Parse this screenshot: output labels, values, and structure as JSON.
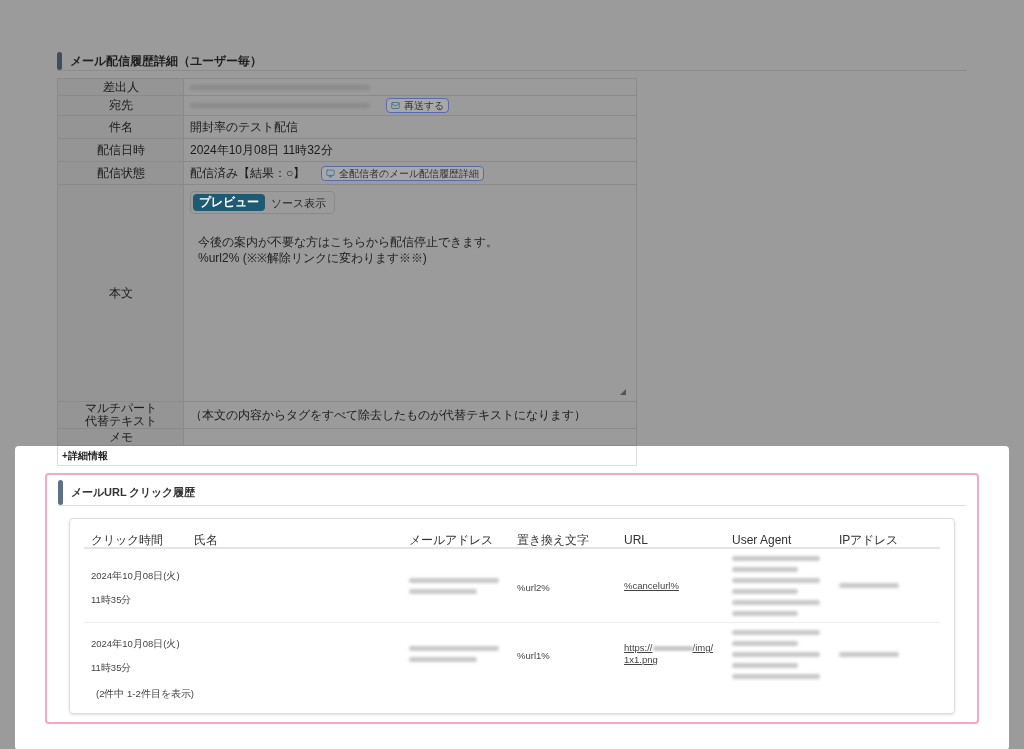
{
  "detail_section": {
    "title": "メール配信履歴詳細（ユーザー毎）",
    "rows": [
      {
        "label": "差出人",
        "kind": "redacted"
      },
      {
        "label": "宛先",
        "kind": "redacted",
        "button": "再送する"
      },
      {
        "label": "件名",
        "kind": "text",
        "value": "開封率のテスト配信"
      },
      {
        "label": "配信日時",
        "kind": "text",
        "value": "2024年10月08日 11時32分"
      },
      {
        "label": "配信状態",
        "kind": "text",
        "value": "配信済み【結果：○】",
        "link_button": "全配信者のメール配信履歴詳細"
      },
      {
        "label": "本文",
        "kind": "editor",
        "tabs": [
          {
            "label": "プレビュー",
            "selected": true
          },
          {
            "label": "ソース表示",
            "selected": false
          }
        ],
        "body": [
          "今後の案内が不要な方はこちらから配信停止できます。",
          "%url2% (※※解除リンクに変わります※※)"
        ]
      },
      {
        "label": "マルチパート代替テキスト",
        "kind": "text",
        "value": "（本文の内容からタグをすべて除去したものが代替テキストになります）"
      },
      {
        "label": "メモ",
        "kind": "text"
      }
    ],
    "more_toggle": "+詳細情報"
  },
  "click_section": {
    "title": "メールURL クリック履歴",
    "columns": [
      "クリック時間",
      "氏名",
      "メールアドレス",
      "置き換え文字",
      "URL",
      "User Agent",
      "IPアドレス"
    ],
    "rows": [
      {
        "time": "2024年10月08日(火) 11時35分",
        "placeholder": "%url2%",
        "url": {
          "before": "%cancelurl%",
          "redacted": false
        }
      },
      {
        "time": "2024年10月08日(火) 11時35分",
        "placeholder": "%url1%",
        "url": {
          "before": "https://",
          "redacted": true,
          "after": "/img/1x1.png"
        }
      }
    ],
    "footer": "(2件中 1-2件目を表示)"
  }
}
